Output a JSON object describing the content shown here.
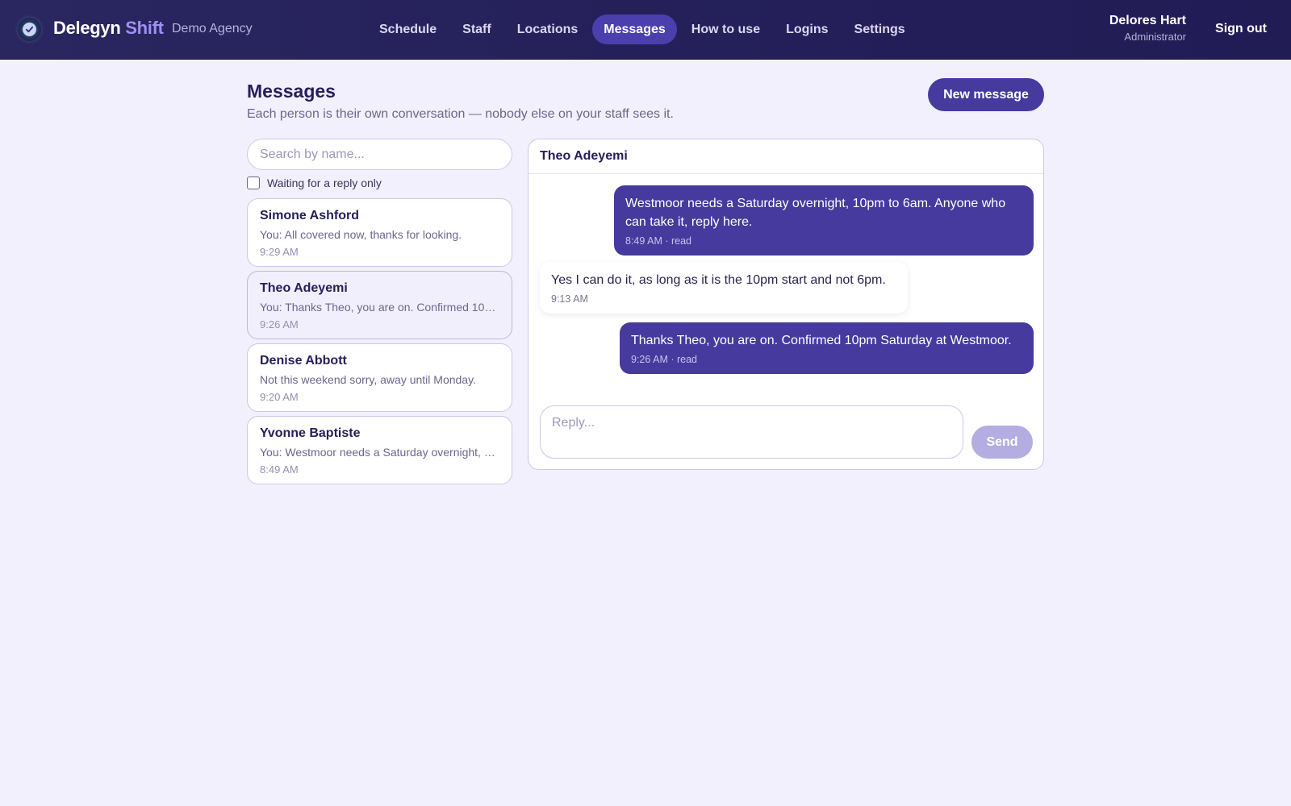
{
  "app": {
    "brand_main": "Delegyn",
    "brand_accent": "Shift",
    "agency": "Demo Agency"
  },
  "nav": {
    "items": [
      {
        "label": "Schedule",
        "active": false
      },
      {
        "label": "Staff",
        "active": false
      },
      {
        "label": "Locations",
        "active": false
      },
      {
        "label": "Messages",
        "active": true
      },
      {
        "label": "How to use",
        "active": false
      },
      {
        "label": "Logins",
        "active": false
      },
      {
        "label": "Settings",
        "active": false
      }
    ]
  },
  "user": {
    "name": "Delores Hart",
    "role": "Administrator",
    "sign_out": "Sign out"
  },
  "page": {
    "title": "Messages",
    "subtitle": "Each person is their own conversation — nobody else on your staff sees it.",
    "new_message_label": "New message"
  },
  "sidebar": {
    "search_placeholder": "Search by name...",
    "filter_label": "Waiting for a reply only",
    "filter_checked": false,
    "conversations": [
      {
        "name": "Simone Ashford",
        "preview": "You: All covered now, thanks for looking.",
        "time": "9:29 AM",
        "selected": false
      },
      {
        "name": "Theo Adeyemi",
        "preview": "You: Thanks Theo, you are on. Confirmed 10pm Saturday at Westmoor.",
        "time": "9:26 AM",
        "selected": true
      },
      {
        "name": "Denise Abbott",
        "preview": "Not this weekend sorry, away until Monday.",
        "time": "9:20 AM",
        "selected": false
      },
      {
        "name": "Yvonne Baptiste",
        "preview": "You: Westmoor needs a Saturday overnight, 10pm to 6am. Anyone who can take it, reply here.",
        "time": "8:49 AM",
        "selected": false
      }
    ]
  },
  "thread": {
    "title": "Theo Adeyemi",
    "messages": [
      {
        "direction": "out",
        "text": "Westmoor needs a Saturday overnight, 10pm to 6am. Anyone who can take it, reply here.",
        "meta": "8:49 AM · read"
      },
      {
        "direction": "in",
        "text": "Yes I can do it, as long as it is the 10pm start and not 6pm.",
        "meta": "9:13 AM"
      },
      {
        "direction": "out",
        "text": "Thanks Theo, you are on. Confirmed 10pm Saturday at Westmoor.",
        "meta": "9:26 AM · read"
      }
    ],
    "reply_placeholder": "Reply...",
    "send_label": "Send"
  },
  "colors": {
    "topbar": "#25205a",
    "accent": "#463a9e",
    "brand_accent": "#9f8ff5",
    "background": "#f2f0fc",
    "send_disabled": "#b4ade2"
  },
  "icons": {
    "logo": "check-circle-icon"
  }
}
